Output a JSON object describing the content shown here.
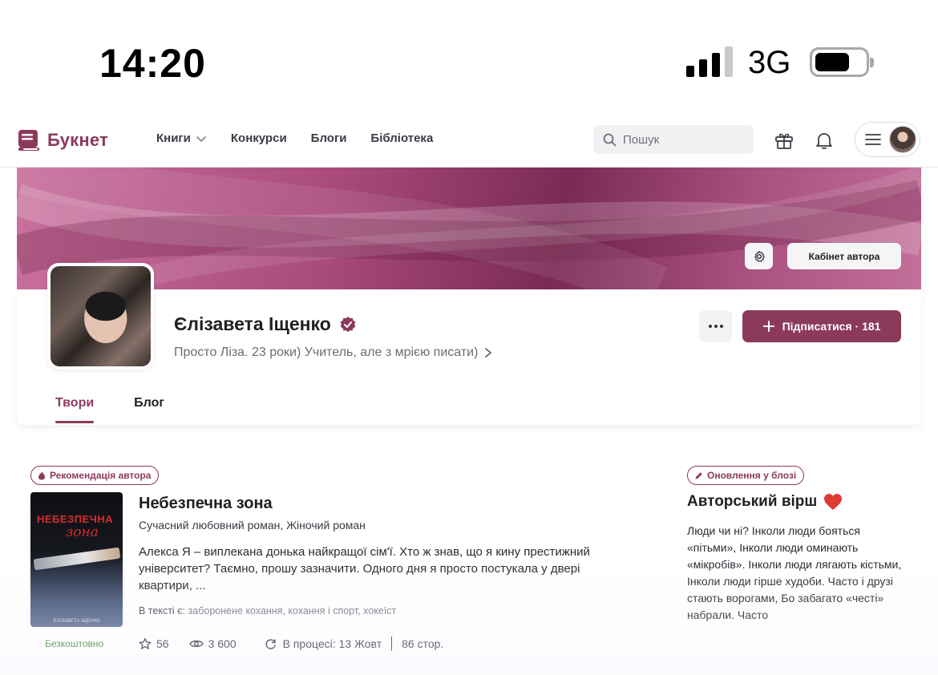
{
  "status_bar": {
    "time": "14:20",
    "network": "3G",
    "signal_bars_filled": 3,
    "signal_bars_total": 4
  },
  "header": {
    "logo_text": "Букнет",
    "nav": [
      "Книги",
      "Конкурси",
      "Блоги",
      "Бібліотека"
    ],
    "search_placeholder": "Пошук"
  },
  "profile": {
    "cabinet_label": "Кабінет автора",
    "name": "Єлізавета Іщенко",
    "bio": "Просто Ліза. 23 роки) Учитель, але з мрією писати)",
    "subscribe_label": "Підписатися · 181",
    "tabs": [
      "Твори",
      "Блог"
    ],
    "active_tab": 0
  },
  "book": {
    "badge": "Рекомендація автора",
    "cover_title_line1": "НЕБЕЗПЕЧНА",
    "cover_title_line2": "зона",
    "cover_author": "ЄЛІЗАВЕТА ІЩЕНКО",
    "price_label": "Безкоштовно",
    "title": "Небезпечна зона",
    "genres": "Сучасний любовний роман, Жіночий роман",
    "description": "Алекса Я – виплекана донька найкращої сім'ї. Хто ж знав, що я кину престижний університет? Таємно, прошу зазначити. Одного дня я просто постукала у двері квартири, ...",
    "tags_prefix": "В тексті є:",
    "tags": "заборонене кохання, кохання і спорт, хокеїст",
    "rating": "56",
    "views": "3 600",
    "status": "В процесі: 13 Жовт",
    "pages": "86 стор."
  },
  "blog": {
    "badge": "Оновлення у блозі",
    "title": "Авторський вірш",
    "text": "Люди чи ні? Інколи люди бояться «пітьми», Інколи люди оминають «мікробів». Інколи люди лягають кістьми, Інколи люди гірше худоби. Часто і друзі стають ворогами, Бо забагато «честі» набрали. Часто"
  },
  "colors": {
    "brand": "#8c3a5c",
    "free_green": "#3d8b3d"
  }
}
